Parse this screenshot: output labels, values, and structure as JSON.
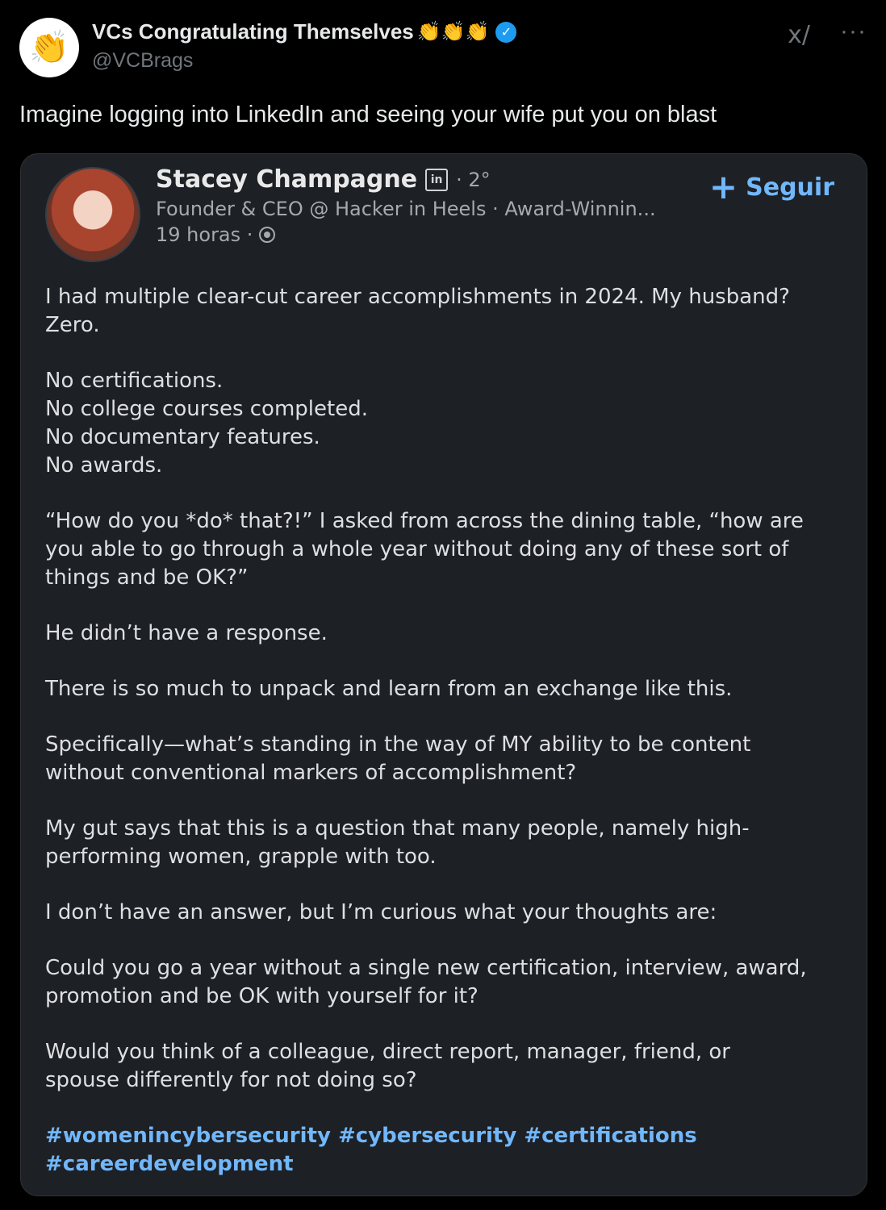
{
  "tweet": {
    "display_name": "VCs Congratulating Themselves",
    "display_name_emoji": "👏👏👏",
    "avatar_emoji": "👏",
    "handle": "@VCBrags",
    "text": "Imagine logging into LinkedIn and seeing your wife put you on blast",
    "more_label": "···",
    "grok_label": "x/"
  },
  "linkedin_post": {
    "author_name": "Stacey Champagne",
    "badge": "in",
    "degree": "· 2°",
    "headline": "Founder & CEO @ Hacker in Heels · Award-Winnin...",
    "time": "19 horas ·",
    "follow_label": "Seguir",
    "paragraphs": [
      "I had multiple clear-cut career accomplishments in 2024. My husband?\nZero.",
      "No certifications.\nNo college courses completed.\nNo documentary features.\nNo awards.",
      "“How do you *do* that?!” I asked from across the dining table, “how are\nyou able to go through a whole year without doing any of these sort of\nthings and be OK?”",
      "He didn’t have a response.",
      "There is so much to unpack and learn from an exchange like this.",
      "Specifically—what’s standing in the way of MY ability to be content\nwithout conventional markers of accomplishment?",
      "My gut says that this is a question that many people, namely high-\nperforming women, grapple with too.",
      "I don’t have an answer, but I’m curious what your thoughts are:",
      "Could you go a year without a single new certification, interview, award,\npromotion and be OK with yourself for it?",
      "Would you think of a colleague, direct report, manager, friend, or\nspouse differently for not doing so?"
    ],
    "hashtags": "#womenincybersecurity #cybersecurity #certifications\n#careerdevelopment"
  }
}
